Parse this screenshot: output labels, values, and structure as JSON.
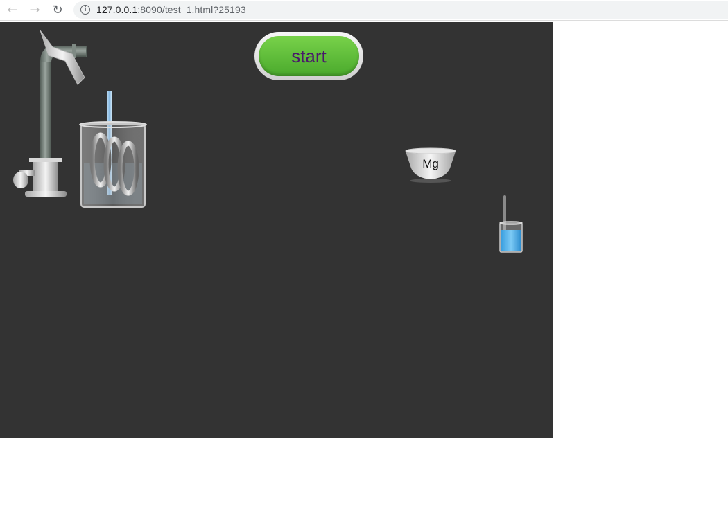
{
  "browser": {
    "url_host": "127.0.0.1",
    "url_rest": ":8090/test_1.html?25193",
    "back_icon": "arrow-left-icon",
    "forward_icon": "arrow-right-icon",
    "reload_icon": "reload-icon",
    "info_icon": "info-icon"
  },
  "stage": {
    "background": "#333333",
    "start_label": "start",
    "bowl_label": "Mg",
    "accent": "#5cbc38"
  }
}
